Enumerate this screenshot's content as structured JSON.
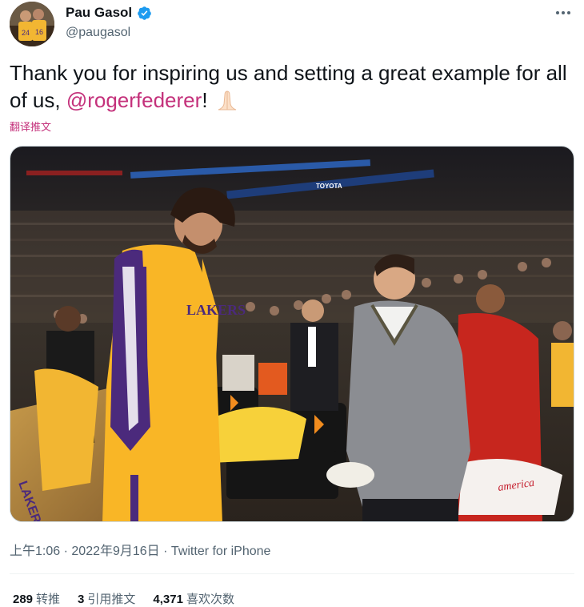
{
  "author": {
    "name": "Pau Gasol",
    "handle": "@paugasol"
  },
  "tweet": {
    "text_before": "Thank you for inspiring us and setting a great example for all of us, ",
    "mention": "@rogerfederer",
    "text_after": "!",
    "emoji": "folded-hands"
  },
  "translate_label": "翻译推文",
  "image": {
    "jersey_text": "LAKERS",
    "sign_text": "TOYOTA",
    "bag_text": "america",
    "courtside_text": "LAKERS.COM"
  },
  "meta": {
    "time": "上午1:06",
    "separator": "·",
    "date": "2022年9月16日",
    "source": "Twitter for iPhone"
  },
  "stats": [
    {
      "count": "289",
      "label": "转推"
    },
    {
      "count": "3",
      "label": "引用推文"
    },
    {
      "count": "4,371",
      "label": "喜欢次数"
    }
  ],
  "colors": {
    "mention": "#c4317b",
    "verified": "#1d9bf0",
    "lakers_gold": "#f9b626",
    "lakers_purple": "#4b2a7c"
  }
}
